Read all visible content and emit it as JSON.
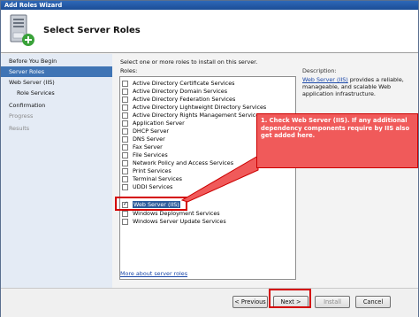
{
  "window": {
    "title": "Add Roles Wizard"
  },
  "header": {
    "title": "Select Server Roles",
    "icon": "server-roles-icon"
  },
  "sidebar": {
    "items": [
      {
        "label": "Before You Begin",
        "state": "normal"
      },
      {
        "label": "Server Roles",
        "state": "selected"
      },
      {
        "label": "Web Server (IIS)",
        "state": "normal"
      },
      {
        "label": "Role Services",
        "state": "sub"
      },
      {
        "label": "Confirmation",
        "state": "normal"
      },
      {
        "label": "Progress",
        "state": "disabled"
      },
      {
        "label": "Results",
        "state": "disabled"
      }
    ]
  },
  "content": {
    "intro": "Select one or more roles to install on this server.",
    "roles_label": "Roles:",
    "roles": [
      {
        "label": "Active Directory Certificate Services",
        "checked": false
      },
      {
        "label": "Active Directory Domain Services",
        "checked": false
      },
      {
        "label": "Active Directory Federation Services",
        "checked": false
      },
      {
        "label": "Active Directory Lightweight Directory Services",
        "checked": false
      },
      {
        "label": "Active Directory Rights Management Services",
        "checked": false
      },
      {
        "label": "Application Server",
        "checked": false
      },
      {
        "label": "DHCP Server",
        "checked": false
      },
      {
        "label": "DNS Server",
        "checked": false
      },
      {
        "label": "Fax Server",
        "checked": false
      },
      {
        "label": "File Services",
        "checked": false
      },
      {
        "label": "Network Policy and Access Services",
        "checked": false
      },
      {
        "label": "Print Services",
        "checked": false
      },
      {
        "label": "Terminal Services",
        "checked": false
      },
      {
        "label": "UDDI Services",
        "checked": false
      },
      {
        "label": "Web Server (IIS)",
        "checked": true
      },
      {
        "label": "Windows Deployment Services",
        "checked": false
      },
      {
        "label": "Windows Server Update Services",
        "checked": false
      }
    ],
    "more_link": "More about server roles",
    "description_label": "Description:",
    "description_link": "Web Server (IIS)",
    "description_text": " provides a reliable, manageable, and scalable Web application infrastructure."
  },
  "annotation": {
    "text": "1. Check Web Server (IIS). If any additional dependency components require by IIS also get added here.",
    "color": "#f05a5a"
  },
  "footer": {
    "previous": "< Previous",
    "next": "Next >",
    "install": "Install",
    "cancel": "Cancel"
  }
}
